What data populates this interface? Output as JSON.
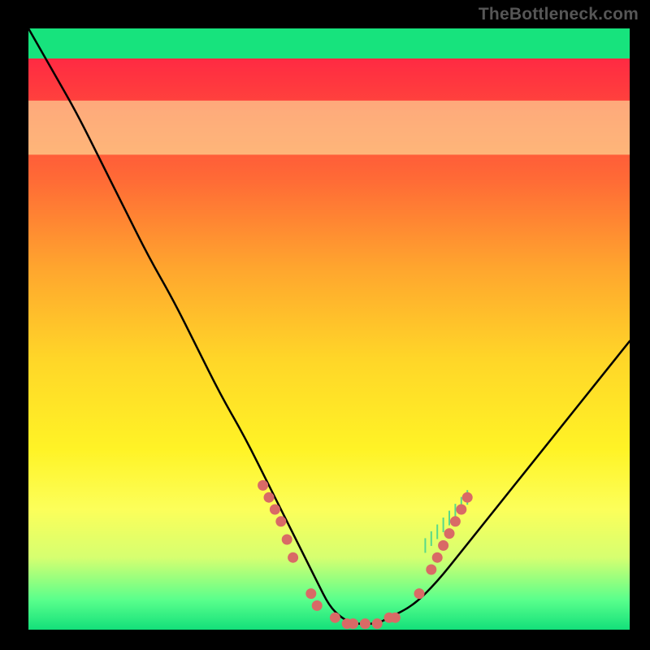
{
  "watermark": "TheBottleneck.com",
  "chart_data": {
    "type": "line",
    "title": "",
    "xlabel": "",
    "ylabel": "",
    "xlim": [
      0,
      100
    ],
    "ylim": [
      0,
      100
    ],
    "grid": false,
    "series": [
      {
        "name": "bottleneck-curve",
        "x": [
          0,
          4,
          8,
          12,
          16,
          20,
          24,
          28,
          32,
          36,
          40,
          44,
          48,
          50,
          52,
          54,
          56,
          58,
          60,
          64,
          68,
          72,
          76,
          80,
          84,
          88,
          92,
          96,
          100
        ],
        "y": [
          100,
          93,
          86,
          78,
          70,
          62,
          55,
          47,
          39,
          32,
          24,
          16,
          8,
          4,
          2,
          1,
          1,
          1,
          2,
          4,
          8,
          13,
          18,
          23,
          28,
          33,
          38,
          43,
          48
        ]
      }
    ],
    "bands": [
      {
        "name": "yellow-band",
        "y0": 79,
        "y1": 88,
        "color": "#fdffaf",
        "opacity": 0.55
      },
      {
        "name": "green-band",
        "y0": 95,
        "y1": 100,
        "color": "#17e37d",
        "opacity": 1.0
      }
    ],
    "markers": {
      "name": "highlighted-points",
      "color": "#d96a66",
      "points": [
        {
          "x": 39,
          "y": 24
        },
        {
          "x": 40,
          "y": 22
        },
        {
          "x": 41,
          "y": 20
        },
        {
          "x": 42,
          "y": 18
        },
        {
          "x": 43,
          "y": 15
        },
        {
          "x": 44,
          "y": 12
        },
        {
          "x": 47,
          "y": 6
        },
        {
          "x": 48,
          "y": 4
        },
        {
          "x": 51,
          "y": 2
        },
        {
          "x": 53,
          "y": 1
        },
        {
          "x": 54,
          "y": 1
        },
        {
          "x": 56,
          "y": 1
        },
        {
          "x": 58,
          "y": 1
        },
        {
          "x": 60,
          "y": 2
        },
        {
          "x": 61,
          "y": 2
        },
        {
          "x": 65,
          "y": 6
        },
        {
          "x": 67,
          "y": 10
        },
        {
          "x": 68,
          "y": 12
        },
        {
          "x": 69,
          "y": 14
        },
        {
          "x": 70,
          "y": 16
        },
        {
          "x": 71,
          "y": 18
        },
        {
          "x": 72,
          "y": 20
        },
        {
          "x": 73,
          "y": 22
        }
      ]
    },
    "ticks": {
      "name": "green-ticks",
      "color": "#58d88a",
      "x": [
        66,
        67,
        68,
        69,
        70,
        71,
        72,
        73
      ],
      "y_from": 14,
      "y_to": 22
    }
  }
}
